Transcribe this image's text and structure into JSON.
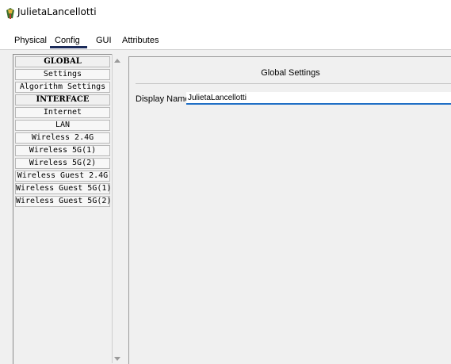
{
  "window": {
    "title": "JulietaLancellotti",
    "icon": "router-icon"
  },
  "tabs": [
    {
      "label": "Physical",
      "active": false
    },
    {
      "label": "Config",
      "active": true
    },
    {
      "label": "GUI",
      "active": false
    },
    {
      "label": "Attributes",
      "active": false
    }
  ],
  "sidebar": {
    "items": [
      {
        "label": "GLOBAL",
        "header": true
      },
      {
        "label": "Settings"
      },
      {
        "label": "Algorithm Settings"
      },
      {
        "label": "INTERFACE",
        "header": true
      },
      {
        "label": "Internet"
      },
      {
        "label": "LAN"
      },
      {
        "label": "Wireless 2.4G"
      },
      {
        "label": "Wireless 5G(1)"
      },
      {
        "label": "Wireless 5G(2)"
      },
      {
        "label": "Wireless Guest 2.4G"
      },
      {
        "label": "Wireless Guest 5G(1)"
      },
      {
        "label": "Wireless Guest 5G(2)"
      }
    ]
  },
  "main": {
    "section_title": "Global Settings",
    "display_name": {
      "label": "Display Name",
      "value": "JulietaLancellotti"
    }
  },
  "colors": {
    "active_tab_underline": "#1b2b5a",
    "input_focus_border": "#1f6fc6"
  }
}
